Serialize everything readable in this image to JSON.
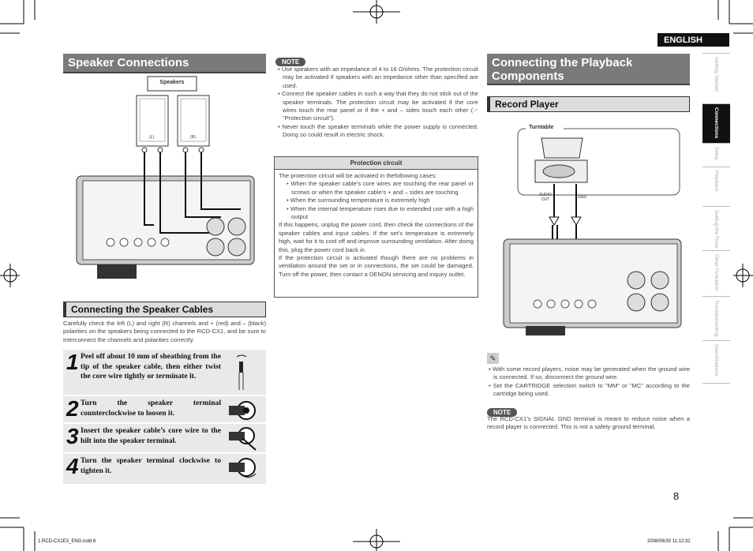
{
  "lang_tab": "ENGLISH",
  "left": {
    "title": "Speaker Connections",
    "diagram": {
      "label": "Speakers",
      "left": "(L)",
      "right": "(R)"
    },
    "sub_title": "Connecting the Speaker Cables",
    "intro": "Carefully check the left (L) and right (R) channels and + (red) and – (black) polarities on the speakers being connected to the RCD-CX1, and be sure to interconnect the channels and polarities correctly.",
    "steps": [
      {
        "n": "1",
        "text": "Peel off about 10 mm of sheathing from the tip of the speaker cable, then either twist the core wire tightly or terminate it."
      },
      {
        "n": "2",
        "text": "Turn the speaker terminal counterclockwise to loosen it."
      },
      {
        "n": "3",
        "text": "Insert the speaker cable’s core wire to the hilt into the speaker terminal."
      },
      {
        "n": "4",
        "text": "Turn the speaker terminal clockwise to tighten it."
      }
    ]
  },
  "middle": {
    "note_label": "NOTE",
    "notes": [
      "Use speakers with an impedance of 4 to 16 Ω/ohms. The protection circuit may be activated if speakers with an impedance other than specified are used.",
      "Connect the speaker cables in such a way that they do not stick out of the speaker terminals. The protection circuit may be activated if the core wires touch the rear panel or if the + and – sides touch each other (☞ \"Protection circuit\").",
      "Never touch the speaker terminals while the power supply is connected. Doing so could result in electric shock."
    ],
    "protection": {
      "title": "Protection circuit",
      "intro": "The protection circuit will be activated in thefollowing cases:",
      "cases": [
        "When the speaker cable’s core wires are touching the rear panel or screws or when the speaker cable’s + and – sides are touching",
        "When the surrounding temperature is extremely high",
        "When the internal temperature rises due to extended use with a high output"
      ],
      "p1": "If this happens, unplug the power cord, then check the connections of the speaker cables and input cables. If the set’s temperature is extremely high, wait for it to cool off and improve surrounding ventilation. After doing this, plug the power cord back in.",
      "p2": "If the protection circuit is activated though there are no problems in ventilation around the set or in connections, the set could be damaged. Turn off the power, then contact a DENON servicing and inquiry outlet."
    }
  },
  "right": {
    "title": "Connecting the Playback Components",
    "sub_title": "Record Player",
    "diagram": {
      "label": "Turntable",
      "audio_out": "AUDIO OUT",
      "gnd": "GND"
    },
    "tips": [
      "With some record players, noise may be generated when the ground wire is connected. If so, disconnect the ground wire.",
      "Set the CARTRIDGE selection switch to \"MM\" or \"MC\" according to the cartridge being used."
    ],
    "note_label": "NOTE",
    "note": "The RCD-CX1’s SIGNAL GND terminal is meant to reduce noise when a record player is connected. This is not a safety ground terminal."
  },
  "side_tabs": [
    {
      "label": "Getting Started",
      "active": false
    },
    {
      "label": "Connections",
      "active": true
    },
    {
      "label": "Setup",
      "active": false
    },
    {
      "label": "Playback",
      "active": false
    },
    {
      "label": "Setting the Timer",
      "active": false
    },
    {
      "label": "Other Functions",
      "active": false
    },
    {
      "label": "Troubleshooting",
      "active": false
    },
    {
      "label": "Specifications",
      "active": false
    }
  ],
  "page_number": "8",
  "footer": {
    "file": "1.RCD-CX1E3_ENG.indd   8",
    "date": "2008/06/30   11:12:32"
  }
}
